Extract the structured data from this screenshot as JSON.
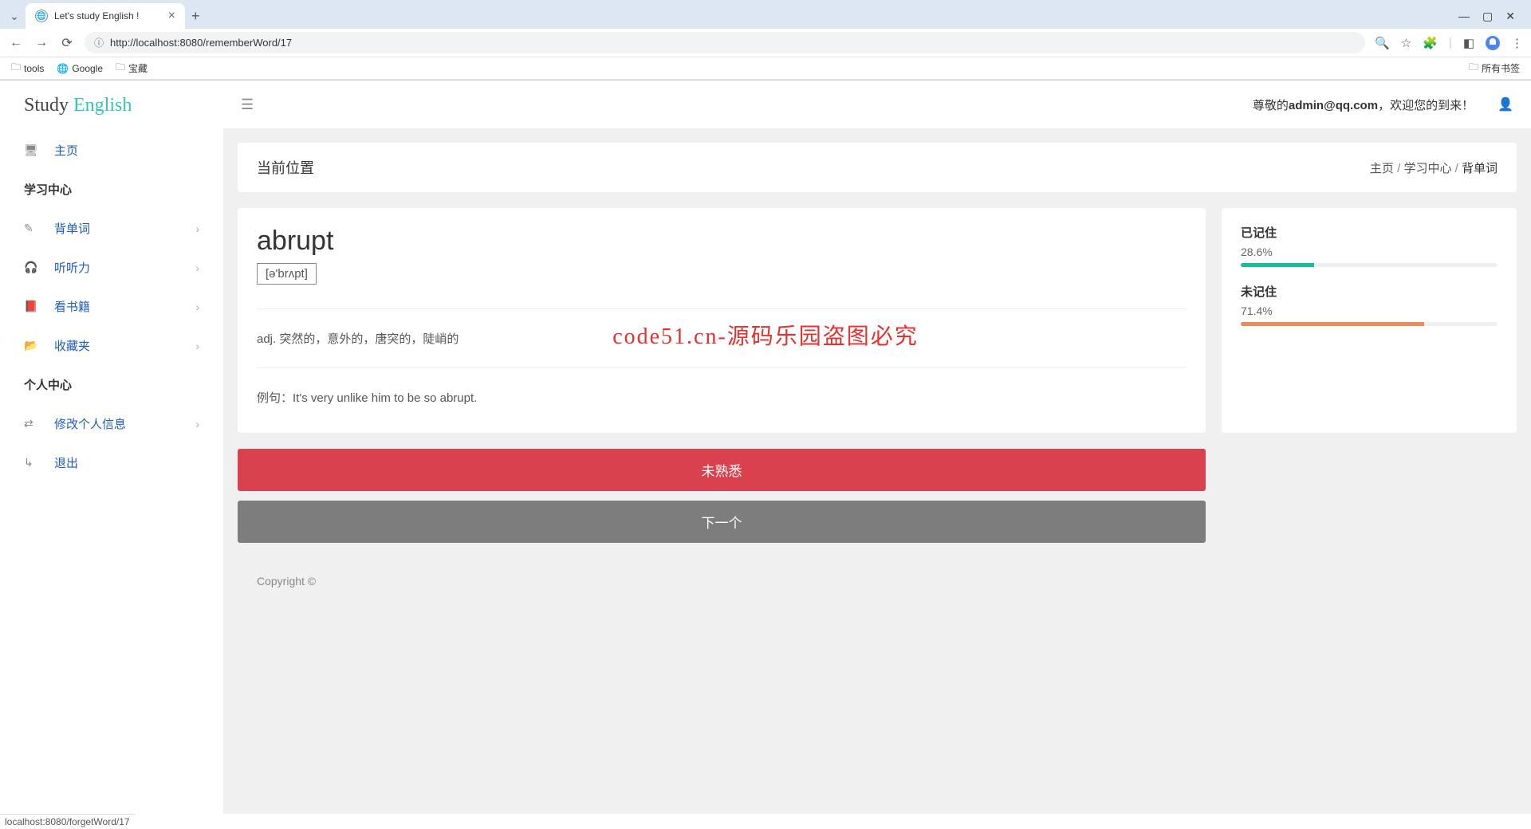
{
  "browser": {
    "tab_title": "Let's study English !",
    "url": "http://localhost:8080/rememberWord/17",
    "bookmarks": [
      "tools",
      "Google",
      "宝藏"
    ],
    "all_bookmarks_label": "所有书签",
    "status_bar": "localhost:8080/forgetWord/17"
  },
  "logo": {
    "part1": "Study",
    "part2": "English"
  },
  "sidebar": {
    "home": "主页",
    "section_study": "学习中心",
    "items_study": [
      "背单词",
      "听听力",
      "看书籍",
      "收藏夹"
    ],
    "section_personal": "个人中心",
    "items_personal": [
      "修改个人信息",
      "退出"
    ]
  },
  "topbar": {
    "welcome_prefix": "尊敬的",
    "welcome_user": "admin@qq.com",
    "welcome_suffix": "，欢迎您的到来！"
  },
  "breadcrumb": {
    "label": "当前位置",
    "crumb1": "主页",
    "crumb2": "学习中心",
    "crumb3": "背单词"
  },
  "word": {
    "title": "abrupt",
    "pronunciation": "[ə'brʌpt]",
    "definition": "adj. 突然的，意外的，唐突的，陡峭的",
    "example_prefix": "例句：",
    "example_text": "It's very unlike him to be so abrupt."
  },
  "stats": {
    "remembered_label": "已记住",
    "remembered_value": "28.6%",
    "remembered_pct": 28.6,
    "not_remembered_label": "未记住",
    "not_remembered_value": "71.4%",
    "not_remembered_pct": 71.4
  },
  "buttons": {
    "unfamiliar": "未熟悉",
    "next": "下一个"
  },
  "footer": "Copyright ©",
  "watermark": "code51.cn",
  "center_watermark": "code51.cn-源码乐园盗图必究"
}
